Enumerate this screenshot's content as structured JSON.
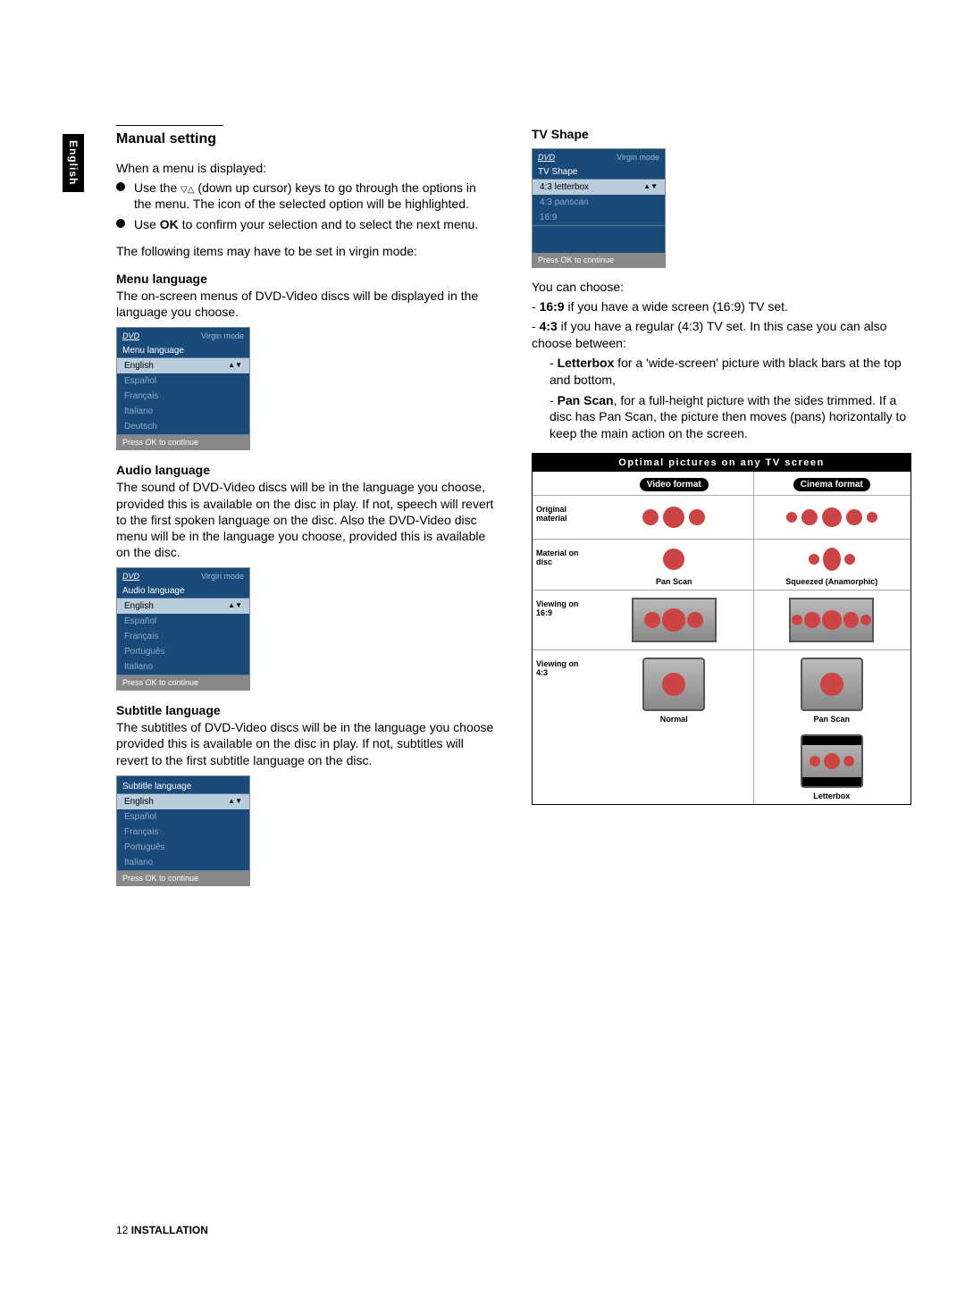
{
  "lang_tab": "English",
  "heading": "Manual setting",
  "intro": "When a menu is displayed:",
  "bullet1_pre": "Use the ",
  "bullet1_post": " (down up cursor) keys to go through the options in the menu. The icon of the selected option will be highlighted.",
  "bullet2_pre": "Use ",
  "bullet2_bold": "OK",
  "bullet2_post": " to confirm your selection and to select the next menu.",
  "following": "The following items may have to be set in virgin mode:",
  "menu_lang_h": "Menu language",
  "menu_lang_p": "The on-screen menus of DVD-Video discs will be displayed in the language you choose.",
  "osd": {
    "dvd": "DVD",
    "mode": "Virgin mode",
    "footer": "Press OK to continue",
    "menu_lang": {
      "title": "Menu language",
      "items": [
        "English",
        "Español",
        "Français",
        "Italiano",
        "Deutsch"
      ]
    },
    "audio_lang": {
      "title": "Audio language",
      "items": [
        "English",
        "Español",
        "Français",
        "Português",
        "Italiano"
      ]
    },
    "subtitle_lang": {
      "title": "Subtitle language",
      "items": [
        "English",
        "Español",
        "Français",
        "Português",
        "Italiano"
      ]
    },
    "tv_shape": {
      "title": "TV Shape",
      "items": [
        "4:3 letterbox",
        "4:3 panscan",
        "16:9"
      ]
    }
  },
  "audio_lang_h": "Audio language",
  "audio_lang_p": "The sound of DVD-Video discs will be in the language you choose, provided this is available on the disc in play. If not, speech will revert to the first spoken language on the disc. Also the DVD-Video disc menu will be in the language you choose, provided this is available on the disc.",
  "subtitle_lang_h": "Subtitle language",
  "subtitle_lang_p": "The subtitles of DVD-Video discs will be in the language you choose provided this is available on the disc in play. If not, subtitles will revert to the first subtitle language on the disc.",
  "tv_shape_h": "TV Shape",
  "tv_can_choose": "You can choose:",
  "tv_169_b": "16:9",
  "tv_169_t": " if you have a wide screen (16:9) TV set.",
  "tv_43_b": "4:3",
  "tv_43_t": " if you have a regular (4:3) TV set. In this case you can also choose between:",
  "tv_lb_b": "Letterbox",
  "tv_lb_t": " for a 'wide-screen' picture with black bars at the top and bottom,",
  "tv_ps_b": "Pan Scan",
  "tv_ps_t": ", for a full-height picture with the sides trimmed. If a disc has Pan Scan, the picture then moves (pans) horizontally to keep the main action on the screen.",
  "diagram": {
    "header": "Optimal pictures on any TV screen",
    "video_format": "Video format",
    "cinema_format": "Cinema format",
    "original_material": "Original material",
    "material_on_disc": "Material on disc",
    "viewing_169": "Viewing on 16:9",
    "viewing_43": "Viewing on 4:3",
    "pan_scan": "Pan Scan",
    "squeezed": "Squeezed (Anamorphic)",
    "normal": "Normal",
    "letterbox": "Letterbox"
  },
  "footer_page": "12",
  "footer_section": "INSTALLATION"
}
